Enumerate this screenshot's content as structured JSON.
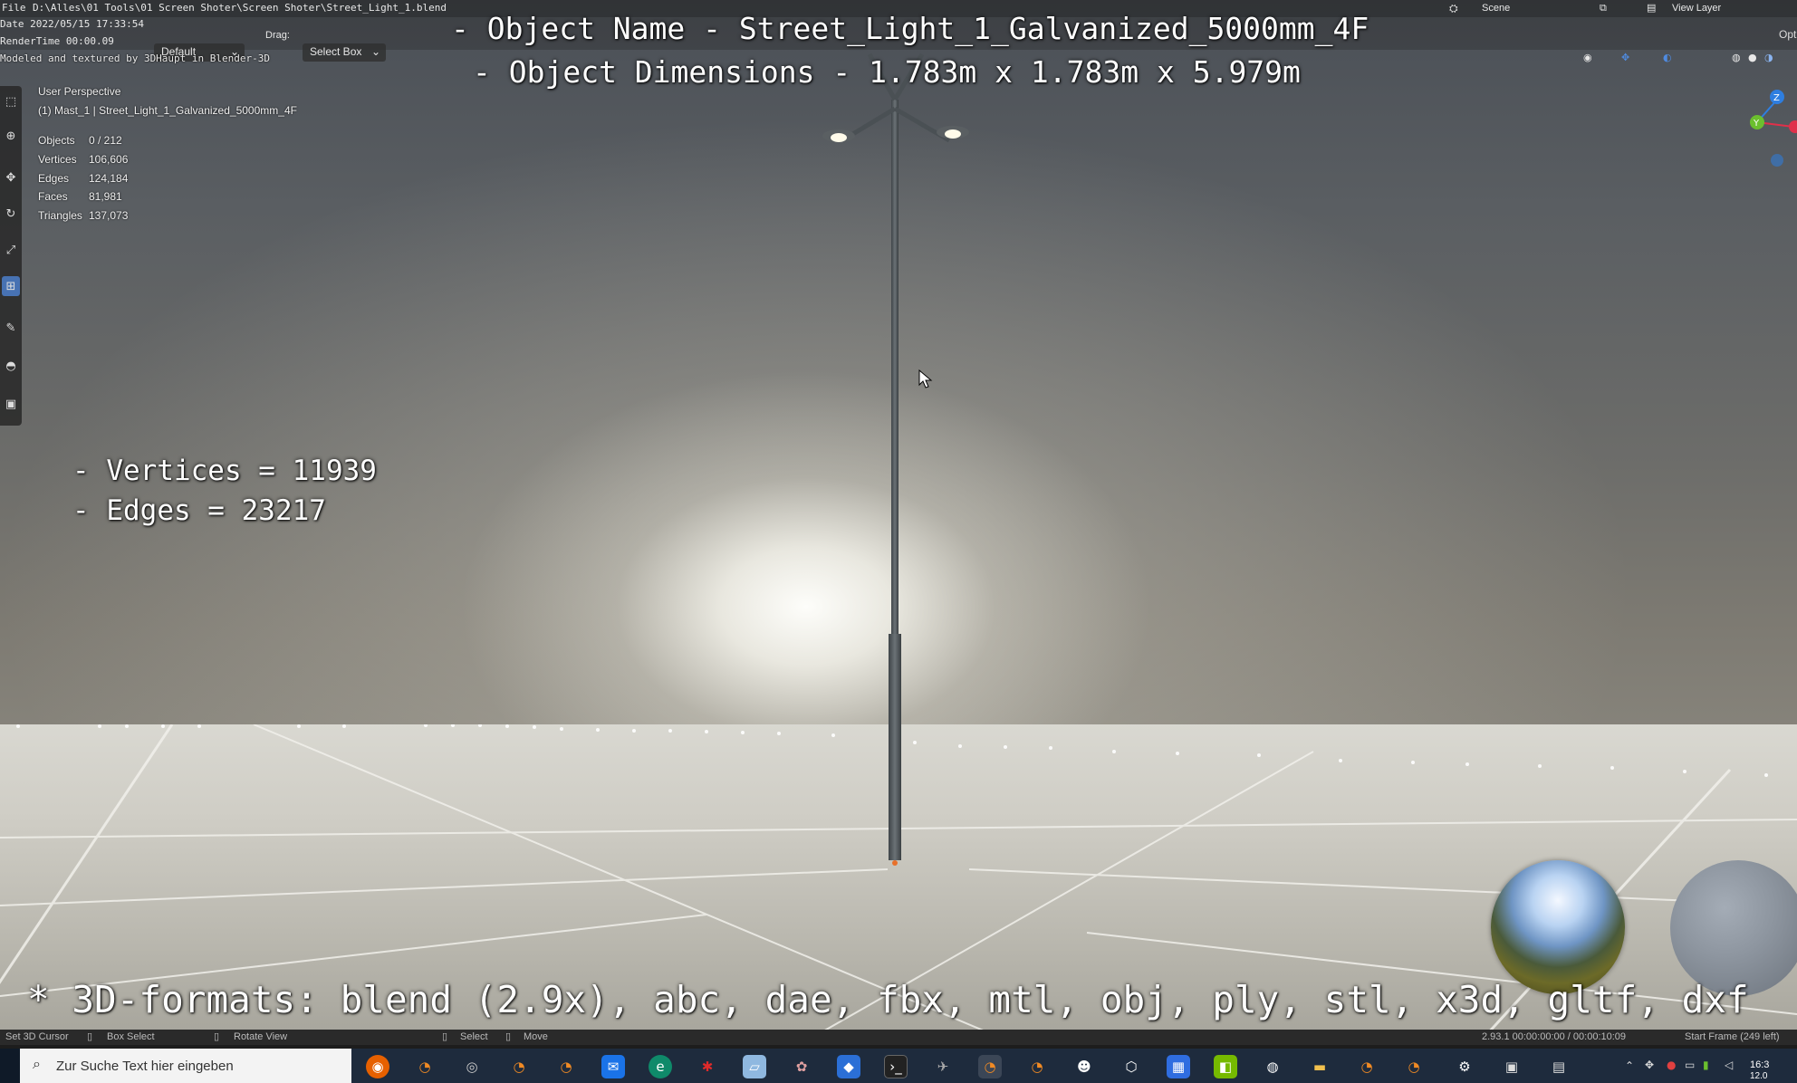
{
  "window": {
    "menu_file": "File",
    "file_path": "D:\\Alles\\01 Tools\\01 Screen Shoter\\Screen Shoter\\Street_Light_1.blend",
    "scene_label": "Scene",
    "view_layer_label": "View Layer",
    "options_label": "Options"
  },
  "stamp": {
    "date": "Date 2022/05/15 17:33:54",
    "render_time": "RenderTime 00:00.09",
    "credit": "Modeled and textured by 3DHaupt in Blender-3D"
  },
  "header": {
    "orientation_label": "Default",
    "drag_label": "Drag:",
    "drag_value": "Select Box"
  },
  "overlay": {
    "object_name_line": "- Object Name - Street_Light_1_Galvanized_5000mm_4F",
    "object_dims_line": "- Object Dimensions -  1.783m x 1.783m x 5.979m",
    "vertices_line": "- Vertices = 11939",
    "edges_line": "- Edges = 23217",
    "formats_line": "* 3D-formats: blend (2.9x), abc, dae, fbx, mtl, obj, ply, stl, x3d, gltf, dxf"
  },
  "viewport_info": {
    "perspective": "User Perspective",
    "collection_object": "(1) Mast_1 | Street_Light_1_Galvanized_5000mm_4F",
    "stats": [
      {
        "label": "Objects",
        "value": "0 / 212"
      },
      {
        "label": "Vertices",
        "value": "106,606"
      },
      {
        "label": "Edges",
        "value": "124,184"
      },
      {
        "label": "Faces",
        "value": "81,981"
      },
      {
        "label": "Triangles",
        "value": "137,073"
      }
    ]
  },
  "statusbar": {
    "set_cursor": "Set 3D Cursor",
    "box_select": "Box Select",
    "rotate_view": "Rotate View",
    "select": "Select",
    "move": "Move",
    "version_time": "2.93.1  00:00:00:00 / 00:00:10:09",
    "start_frame": "Start Frame (249 left)"
  },
  "taskbar": {
    "search_placeholder": "Zur Suche Text hier eingeben",
    "clock_time": "16:3",
    "clock_date": "12.0"
  },
  "gizmo": {
    "z_label": "Z",
    "y_label": "Y"
  },
  "colors": {
    "accent": "#4772b3",
    "axis_x": "#e0304a",
    "axis_y": "#6bbf2e",
    "axis_z": "#2e7ee0"
  }
}
